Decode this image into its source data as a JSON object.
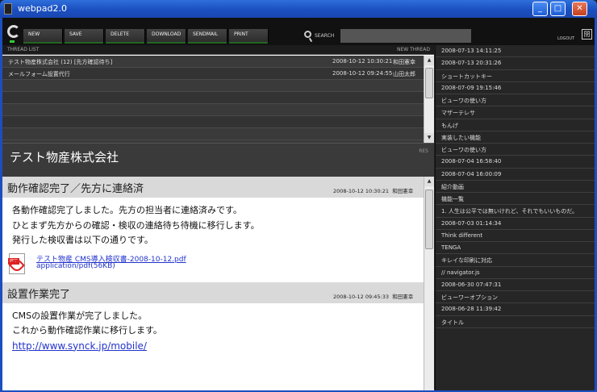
{
  "window": {
    "title": "webpad2.0",
    "minimize": "_",
    "maximize": "□",
    "close": "✕"
  },
  "toolbar": {
    "buttons": [
      "NEW",
      "SAVE",
      "DELETE",
      "DOWNLOAD",
      "SENDMAIL",
      "PRINT"
    ],
    "search_label": "SEARCH",
    "search_value": "",
    "logout_label": "LOGOUT",
    "logout_glyph": "閉"
  },
  "thread_list": {
    "header": "THREAD LIST",
    "new_thread": "NEW THREAD",
    "rows": [
      {
        "title": "テスト物産株式会社 (12) [先方確認待ち]",
        "date": "2008-10-12 10:30:21",
        "author": "和田憲幸"
      },
      {
        "title": "メールフォーム設置代行",
        "date": "2008-10-12 09:24:55",
        "author": "山田太郎"
      }
    ]
  },
  "thread": {
    "subject": "テスト物産株式会社",
    "res_label": "RES"
  },
  "messages": [
    {
      "title": "動作確認完了／先方に連絡済",
      "date": "2008-10-12 10:30:21",
      "author": "和田憲幸",
      "lines": [
        "各動作確認完了しました。先方の担当者に連絡済みです。",
        "ひとまず先方からの確認・検収の連絡待ち待機に移行します。",
        "発行した検収書は以下の通りです。"
      ],
      "attachment": {
        "name": "テスト物産 CMS導入検収書-2008-10-12.pdf",
        "meta": "application/pdf(56KB)",
        "icon": "pdf-icon"
      }
    },
    {
      "title": "設置作業完了",
      "date": "2008-10-12 09:45:33",
      "author": "和田憲幸",
      "lines": [
        "CMSの設置作業が完了しました。",
        "これから動作確認作業に移行します。"
      ],
      "link": "http://www.synck.jp/mobile/"
    }
  ],
  "sidebar": {
    "items": [
      "2008-07-13 14:11:25",
      "2008-07-13 20:31:26",
      "ショートカットキー",
      "2008-07-09 19:15:46",
      "ビューワの使い方",
      "マザーテレサ",
      "もんげ",
      "実装したい機能",
      "ビューワの使い方",
      "2008-07-04 16:58:40",
      "2008-07-04 16:00:09",
      "紹介動画",
      "機能一覧",
      "1. 人生は公平では無いけれど、それでもいいものだ。",
      "2008-07-03 01:14:34",
      "Think different",
      "TENGA",
      "キレイな印刷に対応",
      "// navigator.js",
      "2008-06-30 07:47:31",
      "ビューワーオプション",
      "2008-06-28 11:39:42",
      "タイトル"
    ]
  },
  "colors": {
    "title_bar": "#1b4fc0",
    "toolbar": "#111111",
    "link": "#2233cc",
    "message_header": "#d9d9d9"
  }
}
